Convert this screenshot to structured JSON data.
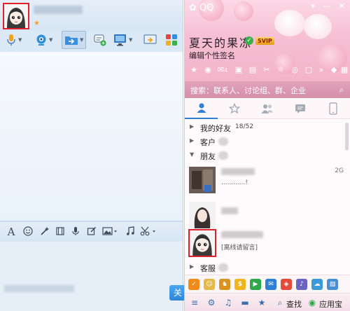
{
  "chat_window": {
    "send_label": "关"
  },
  "qq_panel": {
    "nickname": "夏天的果冻",
    "vip_badge": "SVIP",
    "signature": "编辑个性签名",
    "mail_count": "4",
    "search_placeholder": "搜索：联系人、讨论组、群、企业",
    "groups": [
      {
        "name": "我的好友",
        "count": "18/52",
        "expanded": false
      },
      {
        "name": "客户",
        "count": "",
        "expanded": false
      },
      {
        "name": "朋友",
        "count": "",
        "expanded": true
      },
      {
        "name": "客服",
        "count": "",
        "expanded": false
      }
    ],
    "contacts": [
      {
        "status": "............!",
        "network": "2G"
      },
      {
        "status": "",
        "network": ""
      },
      {
        "status": "[离线请留言]",
        "network": ""
      }
    ],
    "bottom": {
      "find_label": "查找",
      "appstore_label": "应用宝"
    }
  },
  "colors": {
    "selection_border": "#e0202a",
    "skin_pink": "#f6bfd3",
    "chat_blue": "#dbe8f6",
    "send_blue": "#2d86d8"
  }
}
